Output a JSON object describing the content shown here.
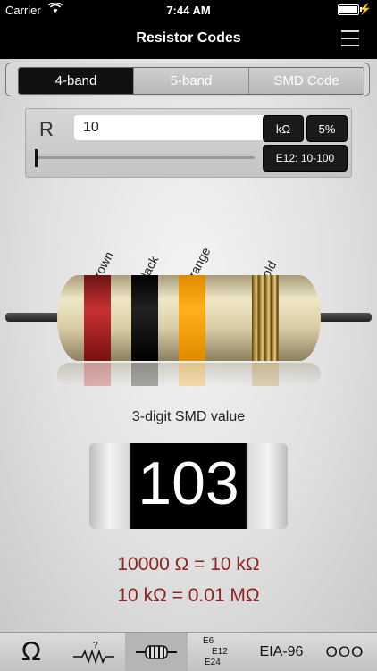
{
  "status": {
    "carrier": "Carrier",
    "time": "7:44 AM"
  },
  "nav": {
    "title": "Resistor Codes"
  },
  "segments": [
    "4-band",
    "5-band",
    "SMD Code"
  ],
  "input": {
    "label": "R",
    "value": "10",
    "unit": "kΩ",
    "tolerance": "5%",
    "series": "E12: 10-100",
    "slider_fraction": 0
  },
  "bands": [
    "brown",
    "black",
    "orange",
    "gold"
  ],
  "smd": {
    "caption": "3-digit SMD value",
    "code": "103"
  },
  "conversions": [
    "10000 Ω = 10 kΩ",
    "10 kΩ = 0.01 MΩ"
  ],
  "tabs": {
    "ohm": "Ω",
    "e6": "E6",
    "e12": "E12",
    "e24": "E24",
    "eia": "EIA-96",
    "ooo": "OOO"
  },
  "colors": {
    "accent_text": "#8f2323",
    "active_segment": "#111111"
  }
}
